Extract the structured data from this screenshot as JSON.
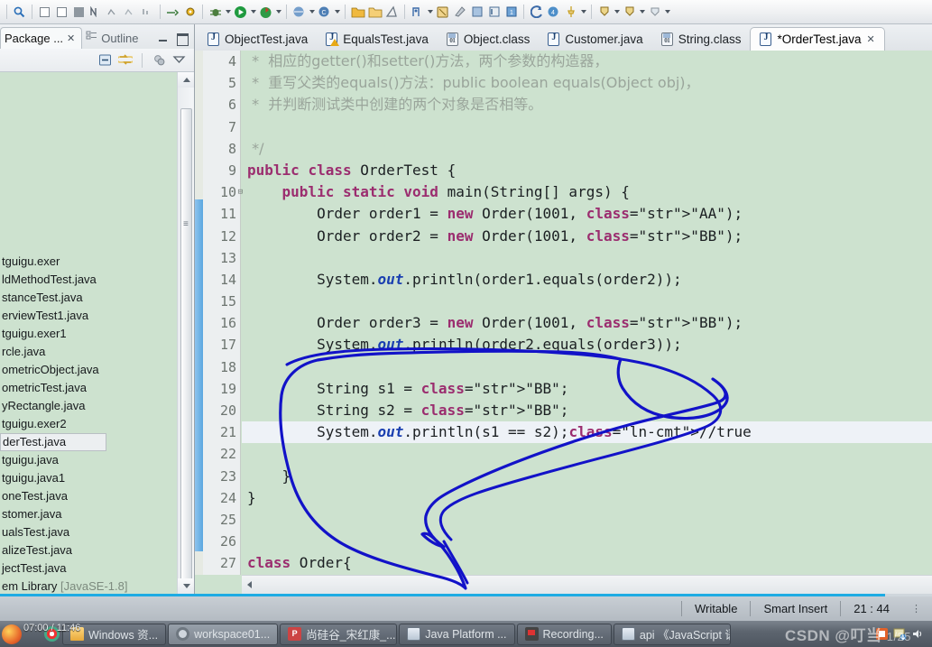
{
  "toolbar": {
    "icons": [
      "search-icon",
      "step-into-icon",
      "step-over-icon",
      "step-return-icon",
      "skip-breakpoints-icon",
      "instrument-1-icon",
      "instrument-2-icon",
      "instrument-3-icon",
      "run-last-tool-icon",
      "external-tools-icon",
      "debug-icon",
      "run-icon",
      "coverage-icon",
      "new-java-project-icon",
      "new-class-icon",
      "new-package-icon",
      "open-type-icon",
      "search-type-icon",
      "next-annotation-icon",
      "previous-annotation-icon",
      "last-edit-location-icon",
      "back-icon",
      "forward-icon",
      "pin-editor-icon"
    ]
  },
  "left_panel": {
    "tabs": [
      {
        "label": "Package ...",
        "active": true,
        "close": "✕"
      },
      {
        "label": "Outline",
        "active": false
      }
    ],
    "window_buttons": [
      "minimize",
      "maximize"
    ],
    "view_tools": [
      "collapse-all-icon",
      "link-with-editor-icon",
      "focus-on-active-task-icon",
      "view-menu-icon"
    ],
    "files": [
      {
        "label": "tguigu.exer",
        "selected": false
      },
      {
        "label": "ldMethodTest.java",
        "selected": false
      },
      {
        "label": "stanceTest.java",
        "selected": false
      },
      {
        "label": "erviewTest1.java",
        "selected": false
      },
      {
        "label": "tguigu.exer1",
        "selected": false
      },
      {
        "label": "rcle.java",
        "selected": false
      },
      {
        "label": "ometricObject.java",
        "selected": false
      },
      {
        "label": "ometricTest.java",
        "selected": false
      },
      {
        "label": "yRectangle.java",
        "selected": false
      },
      {
        "label": "tguigu.exer2",
        "selected": false
      },
      {
        "label": "derTest.java",
        "selected": true
      },
      {
        "label": "tguigu.java",
        "selected": false
      },
      {
        "label": "tguigu.java1",
        "selected": false
      },
      {
        "label": "oneTest.java",
        "selected": false
      },
      {
        "label": "stomer.java",
        "selected": false
      },
      {
        "label": "ualsTest.java",
        "selected": false
      },
      {
        "label": "alizeTest.java",
        "selected": false
      },
      {
        "label": "jectTest.java",
        "selected": false
      }
    ],
    "library_row": {
      "name": "em Library",
      "detail": "[JavaSE-1.8]"
    }
  },
  "editor": {
    "tabs": [
      {
        "label": "ObjectTest.java",
        "icon": "java-file-icon",
        "active": false,
        "dirty": false
      },
      {
        "label": "EqualsTest.java",
        "icon": "java-file-warning-icon",
        "active": false,
        "dirty": false
      },
      {
        "label": "Object.class",
        "icon": "class-file-icon",
        "active": false,
        "dirty": false
      },
      {
        "label": "Customer.java",
        "icon": "java-file-icon",
        "active": false,
        "dirty": false
      },
      {
        "label": "String.class",
        "icon": "class-file-icon",
        "active": false,
        "dirty": false
      },
      {
        "label": "*OrderTest.java",
        "icon": "java-file-icon",
        "active": true,
        "dirty": true,
        "close": "✕"
      }
    ],
    "first_line_number": 4,
    "current_line": 21,
    "lines": [
      {
        "n": 4,
        "fold": false,
        "text": " *  相应的getter()和setter()方法，两个参数的构造器，",
        "kind": "comment"
      },
      {
        "n": 5,
        "fold": false,
        "text": " *  重写父类的equals()方法：public boolean equals(Object obj)，",
        "kind": "comment"
      },
      {
        "n": 6,
        "fold": false,
        "text": " *  并判断测试类中创建的两个对象是否相等。",
        "kind": "comment"
      },
      {
        "n": 7,
        "fold": false,
        "text": "",
        "kind": "comment"
      },
      {
        "n": 8,
        "fold": false,
        "text": " */",
        "kind": "comment"
      },
      {
        "n": 9,
        "fold": false,
        "text": "public class OrderTest {",
        "kind": "code"
      },
      {
        "n": 10,
        "fold": true,
        "text": "    public static void main(String[] args) {",
        "kind": "code"
      },
      {
        "n": 11,
        "fold": false,
        "text": "        Order order1 = new Order(1001, \"AA\");",
        "kind": "code"
      },
      {
        "n": 12,
        "fold": false,
        "text": "        Order order2 = new Order(1001, \"BB\");",
        "kind": "code"
      },
      {
        "n": 13,
        "fold": false,
        "text": "",
        "kind": "code"
      },
      {
        "n": 14,
        "fold": false,
        "text": "        System.out.println(order1.equals(order2));",
        "kind": "code"
      },
      {
        "n": 15,
        "fold": false,
        "text": "",
        "kind": "code"
      },
      {
        "n": 16,
        "fold": false,
        "text": "        Order order3 = new Order(1001, \"BB\");",
        "kind": "code"
      },
      {
        "n": 17,
        "fold": false,
        "text": "        System.out.println(order2.equals(order3));",
        "kind": "code"
      },
      {
        "n": 18,
        "fold": false,
        "text": "",
        "kind": "code"
      },
      {
        "n": 19,
        "fold": false,
        "text": "        String s1 = \"BB\";",
        "kind": "code"
      },
      {
        "n": 20,
        "fold": false,
        "text": "        String s2 = \"BB\";",
        "kind": "code"
      },
      {
        "n": 21,
        "fold": false,
        "text": "        System.out.println(s1 == s2);//true",
        "kind": "code"
      },
      {
        "n": 22,
        "fold": false,
        "text": "",
        "kind": "code"
      },
      {
        "n": 23,
        "fold": false,
        "text": "    }",
        "kind": "code"
      },
      {
        "n": 24,
        "fold": false,
        "text": "}",
        "kind": "code"
      },
      {
        "n": 25,
        "fold": false,
        "text": "",
        "kind": "code"
      },
      {
        "n": 26,
        "fold": false,
        "text": "",
        "kind": "code"
      },
      {
        "n": 27,
        "fold": false,
        "text": "class Order{",
        "kind": "code"
      }
    ],
    "colors": {
      "background": "#cde2cf",
      "gutter": "#eceff0",
      "current_line": "#eef2f7",
      "keyword": "#9b2d6f",
      "string": "#2f4fd6",
      "comment": "#9aa59b",
      "static_field": "#1a3fb0",
      "annotation_ink": "#1212c8"
    }
  },
  "status_bar": {
    "writable": "Writable",
    "insert_mode": "Smart Insert",
    "cursor_position": "21 : 44",
    "progress_percent": 95
  },
  "taskbar": {
    "clock": "07:00 / 11:46",
    "buttons": [
      {
        "label": "Windows 资...",
        "icon": "explorer-icon",
        "active": false
      },
      {
        "label": "workspace01...",
        "icon": "eclipse-icon",
        "active": true
      },
      {
        "label": "尚硅谷_宋红康_...",
        "icon": "powerpoint-icon",
        "active": false
      },
      {
        "label": "Java Platform ...",
        "icon": "java-help-icon",
        "active": false
      },
      {
        "label": "Recording...",
        "icon": "recorder-icon",
        "active": false
      },
      {
        "label": "api 《JavaScript 语言参考",
        "icon": "java-help-icon",
        "active": false
      }
    ],
    "tray_icons": [
      "orange-app-icon",
      "update-icon",
      "volume-icon"
    ]
  },
  "watermark": {
    "text": "CSDN @叮当",
    "suffix": "1/25"
  }
}
